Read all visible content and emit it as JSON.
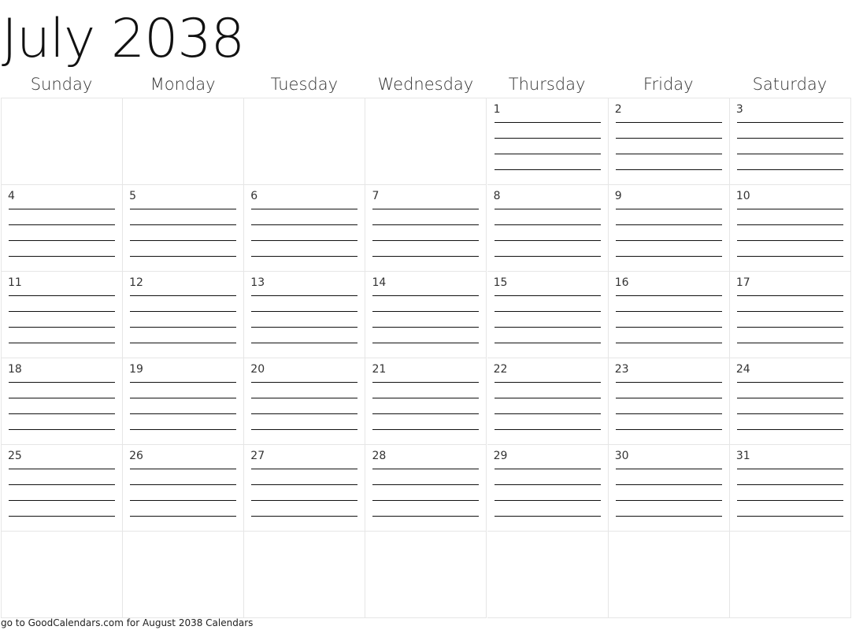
{
  "title": "July 2038",
  "weekdays": [
    "Sunday",
    "Monday",
    "Tuesday",
    "Wednesday",
    "Thursday",
    "Friday",
    "Saturday"
  ],
  "weeks": [
    [
      "",
      "",
      "",
      "",
      "1",
      "2",
      "3"
    ],
    [
      "4",
      "5",
      "6",
      "7",
      "8",
      "9",
      "10"
    ],
    [
      "11",
      "12",
      "13",
      "14",
      "15",
      "16",
      "17"
    ],
    [
      "18",
      "19",
      "20",
      "21",
      "22",
      "23",
      "24"
    ],
    [
      "25",
      "26",
      "27",
      "28",
      "29",
      "30",
      "31"
    ],
    [
      "",
      "",
      "",
      "",
      "",
      "",
      ""
    ]
  ],
  "lines_per_day": 4,
  "footer": "go to GoodCalendars.com for August 2038 Calendars"
}
